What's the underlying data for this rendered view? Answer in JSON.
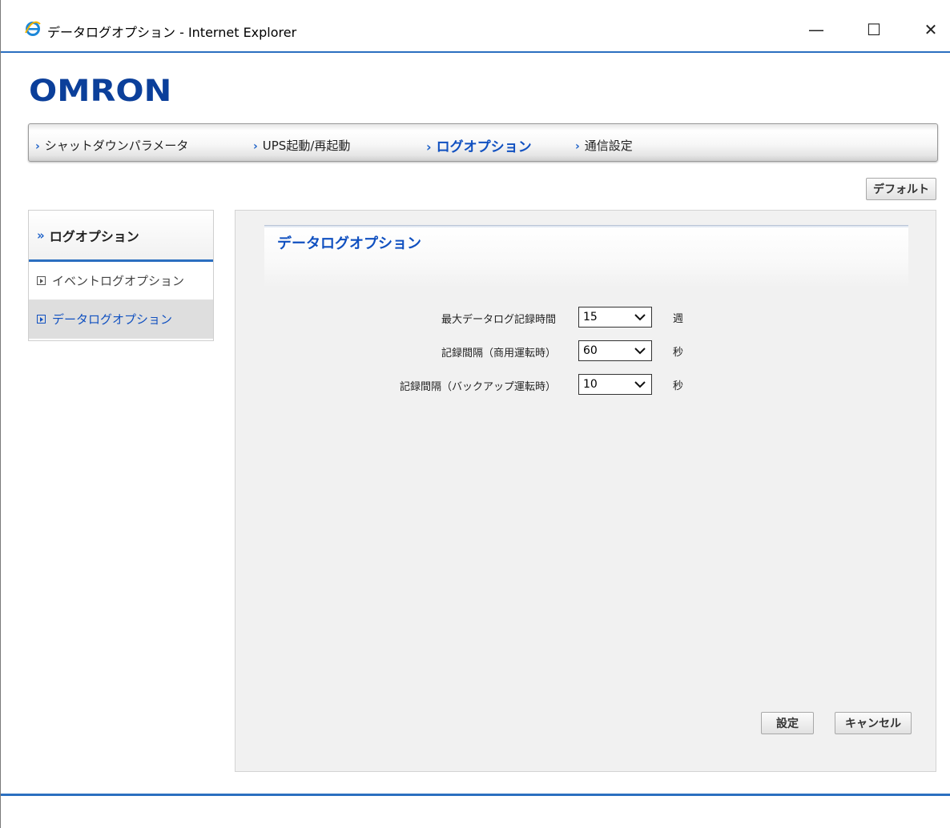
{
  "window": {
    "title": "データログオプション - Internet Explorer",
    "minimize_glyph": "—",
    "maximize_glyph": "☐",
    "close_glyph": "✕"
  },
  "logo": {
    "text": "OMRON"
  },
  "topnav": {
    "items": [
      {
        "label": "シャットダウンパラメータ",
        "active": false
      },
      {
        "label": "UPS起動/再起動",
        "active": false
      },
      {
        "label": "ログオプション",
        "active": true
      },
      {
        "label": "通信設定",
        "active": false
      }
    ]
  },
  "default_button": "デフォルト",
  "sidebar": {
    "heading": "ログオプション",
    "items": [
      {
        "label": "イベントログオプション",
        "active": false
      },
      {
        "label": "データログオプション",
        "active": true
      }
    ]
  },
  "panel": {
    "title": "データログオプション",
    "fields": [
      {
        "label": "最大データログ記録時間",
        "value": "15",
        "unit": "週"
      },
      {
        "label": "記録間隔（商用運転時）",
        "value": "60",
        "unit": "秒"
      },
      {
        "label": "記録間隔（バックアップ運転時）",
        "value": "10",
        "unit": "秒"
      }
    ],
    "save_label": "設定",
    "cancel_label": "キャンセル"
  },
  "colors": {
    "accent": "#2b6fc0",
    "link": "#1050c0",
    "logo": "#0b3f9a"
  }
}
